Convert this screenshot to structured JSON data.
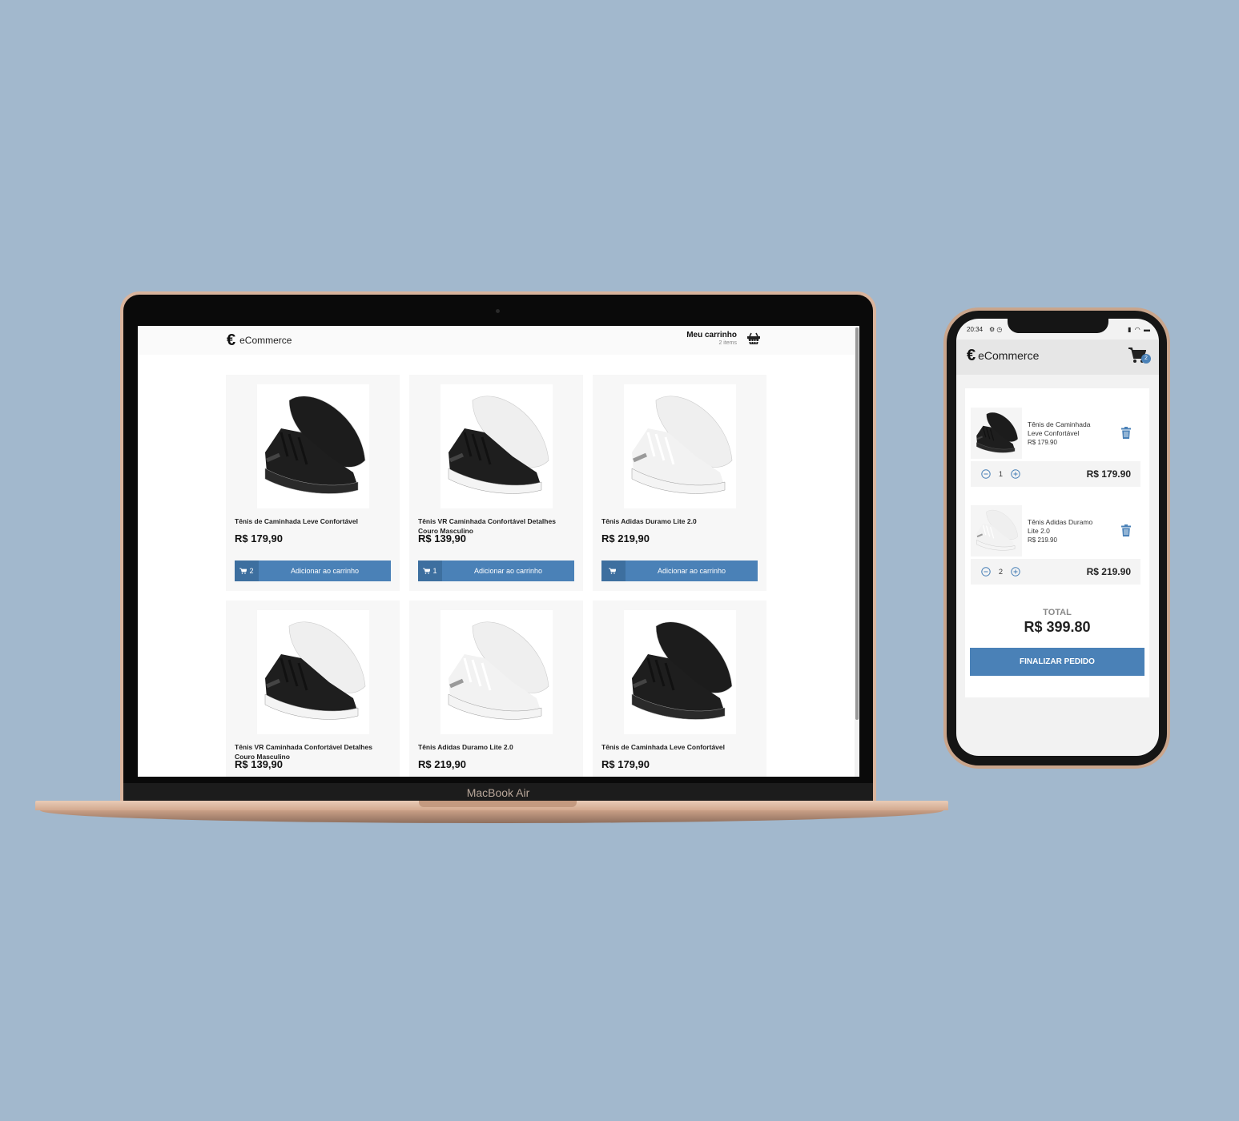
{
  "colors": {
    "background": "#a2b8cd",
    "accent": "#4a81b7",
    "accent_dark": "#3d6f9f"
  },
  "laptop": {
    "brand_label": "MacBook Air",
    "site": {
      "logo_icon": "€",
      "logo_text": "eCommerce",
      "cart_title": "Meu carrinho",
      "cart_count": "2 items",
      "cart_icon": "basket-icon"
    },
    "products": [
      {
        "title": "Tênis de Caminhada Leve Confortável",
        "price": "R$ 179,90",
        "qty": "2",
        "button": "Adicionar ao carrinho",
        "shoe": "black"
      },
      {
        "title": "Tênis VR Caminhada Confortável Detalhes Couro Masculino",
        "price": "R$ 139,90",
        "qty": "1",
        "button": "Adicionar ao carrinho",
        "shoe": "black-white"
      },
      {
        "title": "Tênis Adidas Duramo Lite 2.0",
        "price": "R$ 219,90",
        "qty": "",
        "button": "Adicionar ao carrinho",
        "shoe": "white"
      },
      {
        "title": "Tênis VR Caminhada Confortável Detalhes Couro Masculino",
        "price": "R$ 139,90",
        "shoe": "black-white"
      },
      {
        "title": "Tênis Adidas Duramo Lite 2.0",
        "price": "R$ 219,90",
        "shoe": "white"
      },
      {
        "title": "Tênis de Caminhada Leve Confortável",
        "price": "R$ 179,90",
        "shoe": "black"
      }
    ]
  },
  "phone": {
    "status_time": "20:34",
    "status_icons": "⚙ ◷",
    "status_right": "▮ ◠ ▬",
    "logo_icon": "€",
    "logo_text": "eCommerce",
    "cart_badge": "2",
    "cart_items": [
      {
        "name": "Tênis de Caminhada Leve Confortável",
        "unit_price": "R$ 179.90",
        "qty": "1",
        "line_total": "R$ 179.90",
        "shoe": "black"
      },
      {
        "name": "Tênis Adidas Duramo Lite 2.0",
        "unit_price": "R$ 219.90",
        "qty": "2",
        "line_total": "R$ 219.90",
        "shoe": "white"
      }
    ],
    "total_label": "TOTAL",
    "total_value": "R$ 399.80",
    "checkout_label": "FINALIZAR PEDIDO"
  }
}
